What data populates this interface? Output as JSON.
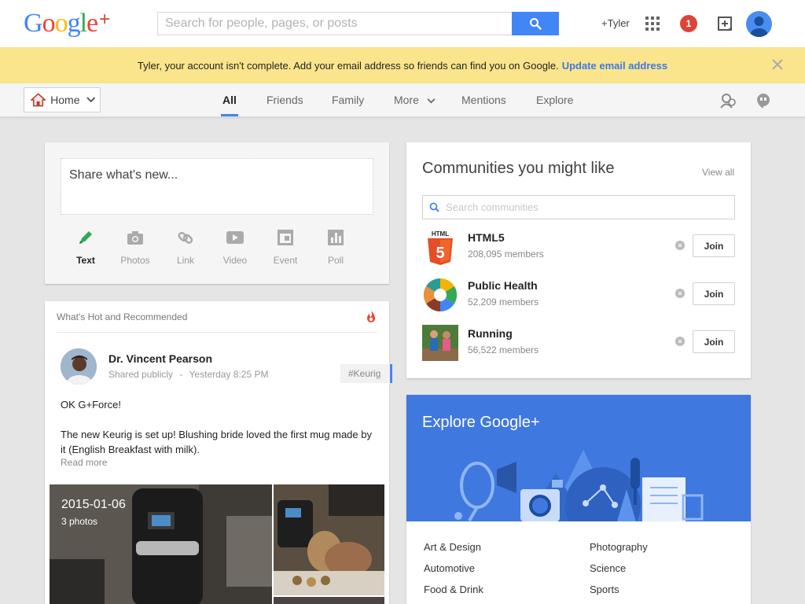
{
  "header": {
    "logo_text": "Google",
    "logo_plus": "+",
    "search_placeholder": "Search for people, pages, or posts",
    "user_name": "+Tyler",
    "notification_count": "1"
  },
  "banner": {
    "message": "Tyler, your account isn't complete. Add your email address so friends can find you on Google.",
    "link": "Update email address"
  },
  "nav": {
    "home_label": "Home",
    "tabs": [
      {
        "label": "All",
        "active": true
      },
      {
        "label": "Friends"
      },
      {
        "label": "Family"
      },
      {
        "label": "More"
      },
      {
        "label": "Mentions"
      },
      {
        "label": "Explore"
      }
    ]
  },
  "share": {
    "placeholder": "Share what's new...",
    "tools": [
      {
        "label": "Text",
        "icon": "pencil-icon"
      },
      {
        "label": "Photos",
        "icon": "camera-icon"
      },
      {
        "label": "Link",
        "icon": "link-icon"
      },
      {
        "label": "Video",
        "icon": "video-icon"
      },
      {
        "label": "Event",
        "icon": "event-icon"
      },
      {
        "label": "Poll",
        "icon": "poll-icon"
      }
    ]
  },
  "post": {
    "section_title": "What's Hot and Recommended",
    "author": "Dr. Vincent Pearson",
    "visibility": "Shared publicly",
    "separator": "-",
    "time": "Yesterday 8:25 PM",
    "tag": "#Keurig",
    "text1": "OK G+Force!",
    "text2": "The new Keurig is set up! Blushing bride loved the first mug made by it (English Breakfast with milk).",
    "read_more": "Read more",
    "album_date": "2015-01-06",
    "album_count": "3 photos"
  },
  "communities": {
    "title": "Communities you might like",
    "view_all": "View all",
    "search_placeholder": "Search communities",
    "join_label": "Join",
    "items": [
      {
        "name": "HTML5",
        "members": "208,095 members"
      },
      {
        "name": "Public Health",
        "members": "52,209 members"
      },
      {
        "name": "Running",
        "members": "56,522 members"
      }
    ]
  },
  "explore": {
    "title": "Explore Google+",
    "links_left": [
      "Art & Design",
      "Automotive",
      "Food & Drink"
    ],
    "links_right": [
      "Photography",
      "Science",
      "Sports"
    ]
  },
  "colors": {
    "accent": "#4285f4",
    "banner": "#fbe58c",
    "explore": "#3f78df",
    "badge": "#db4437"
  }
}
